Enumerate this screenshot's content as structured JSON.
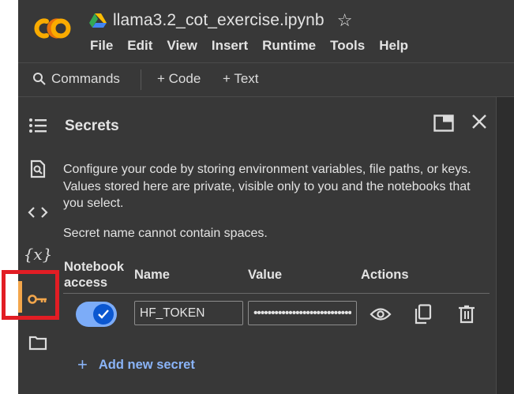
{
  "header": {
    "title": "llama3.2_cot_exercise.ipynb",
    "logo_text": "CO",
    "menu": [
      "File",
      "Edit",
      "View",
      "Insert",
      "Runtime",
      "Tools",
      "Help"
    ]
  },
  "toolbar": {
    "commands": "Commands",
    "code": "+ Code",
    "text": "+ Text"
  },
  "rail": {
    "icons": [
      "table-of-contents-icon",
      "find-icon",
      "code-snippets-icon",
      "variables-icon",
      "key-icon",
      "folder-icon"
    ],
    "active": "key-icon"
  },
  "secrets_panel": {
    "title": "Secrets",
    "description": "Configure your code by storing environment variables, file paths, or keys. Values stored here are private, visible only to you and the notebooks that you select.",
    "note": "Secret name cannot contain spaces.",
    "columns": {
      "notebook_access": "Notebook access",
      "name": "Name",
      "value": "Value",
      "actions": "Actions"
    },
    "secrets": [
      {
        "name": "HF_TOKEN",
        "value": "••••••••••••••••••••••••••••••",
        "notebook_access": true
      }
    ],
    "add_label": "Add new secret"
  },
  "colors": {
    "background": "#383838",
    "accent": "#8ab4f8",
    "toggle_track": "#7cacf8",
    "toggle_knob": "#0b57d0",
    "active_indicator": "#f3a64b",
    "highlight_box": "#e21d24"
  }
}
